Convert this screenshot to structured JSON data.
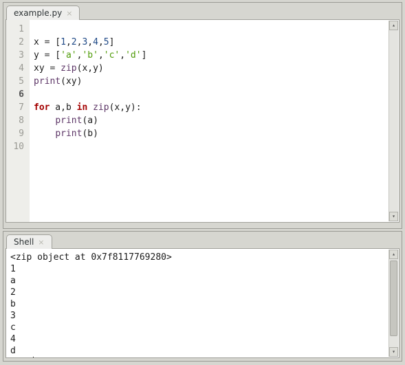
{
  "editor": {
    "tab_label": "example.py",
    "line_numbers": [
      "1",
      "2",
      "3",
      "4",
      "5",
      "6",
      "7",
      "8",
      "9",
      "10"
    ],
    "current_line_index": 5,
    "code_lines": [
      {
        "tokens": []
      },
      {
        "tokens": [
          {
            "t": "x ",
            "c": ""
          },
          {
            "t": "=",
            "c": "op"
          },
          {
            "t": " [",
            "c": ""
          },
          {
            "t": "1",
            "c": "num"
          },
          {
            "t": ",",
            "c": ""
          },
          {
            "t": "2",
            "c": "num"
          },
          {
            "t": ",",
            "c": ""
          },
          {
            "t": "3",
            "c": "num"
          },
          {
            "t": ",",
            "c": ""
          },
          {
            "t": "4",
            "c": "num"
          },
          {
            "t": ",",
            "c": ""
          },
          {
            "t": "5",
            "c": "num"
          },
          {
            "t": "]",
            "c": ""
          }
        ]
      },
      {
        "tokens": [
          {
            "t": "y ",
            "c": ""
          },
          {
            "t": "=",
            "c": "op"
          },
          {
            "t": " [",
            "c": ""
          },
          {
            "t": "'a'",
            "c": "str"
          },
          {
            "t": ",",
            "c": ""
          },
          {
            "t": "'b'",
            "c": "str"
          },
          {
            "t": ",",
            "c": ""
          },
          {
            "t": "'c'",
            "c": "str"
          },
          {
            "t": ",",
            "c": ""
          },
          {
            "t": "'d'",
            "c": "str"
          },
          {
            "t": "]",
            "c": ""
          }
        ]
      },
      {
        "tokens": [
          {
            "t": "xy ",
            "c": ""
          },
          {
            "t": "=",
            "c": "op"
          },
          {
            "t": " ",
            "c": ""
          },
          {
            "t": "zip",
            "c": "bi"
          },
          {
            "t": "(x,y)",
            "c": ""
          }
        ]
      },
      {
        "tokens": [
          {
            "t": "print",
            "c": "bi"
          },
          {
            "t": "(xy)",
            "c": ""
          }
        ]
      },
      {
        "tokens": []
      },
      {
        "tokens": [
          {
            "t": "for",
            "c": "kw"
          },
          {
            "t": " a,b ",
            "c": ""
          },
          {
            "t": "in",
            "c": "kw"
          },
          {
            "t": " ",
            "c": ""
          },
          {
            "t": "zip",
            "c": "bi"
          },
          {
            "t": "(x,y):",
            "c": ""
          }
        ]
      },
      {
        "tokens": [
          {
            "t": "    ",
            "c": ""
          },
          {
            "t": "print",
            "c": "bi"
          },
          {
            "t": "(a)",
            "c": ""
          }
        ]
      },
      {
        "tokens": [
          {
            "t": "    ",
            "c": ""
          },
          {
            "t": "print",
            "c": "bi"
          },
          {
            "t": "(b)",
            "c": ""
          }
        ]
      },
      {
        "tokens": []
      }
    ]
  },
  "shell": {
    "tab_label": "Shell",
    "output_lines": [
      "<zip object at 0x7f8117769280>",
      "1",
      "a",
      "2",
      "b",
      "3",
      "c",
      "4",
      "d"
    ],
    "prompt": ">>> "
  }
}
